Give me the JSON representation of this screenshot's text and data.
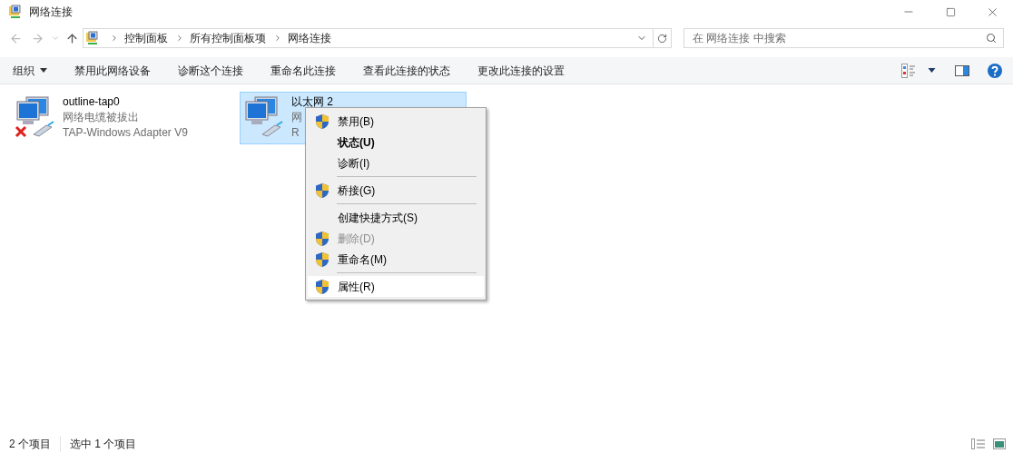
{
  "window": {
    "title": "网络连接"
  },
  "breadcrumb": [
    "控制面板",
    "所有控制面板项",
    "网络连接"
  ],
  "search": {
    "placeholder": "在 网络连接 中搜索"
  },
  "toolbar": [
    {
      "label": "组织",
      "dropdown": true
    },
    {
      "label": "禁用此网络设备",
      "dropdown": false
    },
    {
      "label": "诊断这个连接",
      "dropdown": false
    },
    {
      "label": "重命名此连接",
      "dropdown": false
    },
    {
      "label": "查看此连接的状态",
      "dropdown": false
    },
    {
      "label": "更改此连接的设置",
      "dropdown": false
    }
  ],
  "connections": [
    {
      "name": "outline-tap0",
      "status": "网络电缆被拔出",
      "device": "TAP-Windows Adapter V9",
      "selected": false,
      "disconnected": true
    },
    {
      "name": "以太网 2",
      "status": "网",
      "device": "R",
      "selected": true,
      "disconnected": false
    }
  ],
  "context_menu": [
    {
      "kind": "item",
      "label": "禁用(B)",
      "shield": true,
      "bold": false,
      "disabled": false,
      "selected": false
    },
    {
      "kind": "item",
      "label": "状态(U)",
      "shield": false,
      "bold": true,
      "disabled": false,
      "selected": false
    },
    {
      "kind": "item",
      "label": "诊断(I)",
      "shield": false,
      "bold": false,
      "disabled": false,
      "selected": false
    },
    {
      "kind": "separator"
    },
    {
      "kind": "item",
      "label": "桥接(G)",
      "shield": true,
      "bold": false,
      "disabled": false,
      "selected": false
    },
    {
      "kind": "separator"
    },
    {
      "kind": "item",
      "label": "创建快捷方式(S)",
      "shield": false,
      "bold": false,
      "disabled": false,
      "selected": false
    },
    {
      "kind": "item",
      "label": "删除(D)",
      "shield": true,
      "bold": false,
      "disabled": true,
      "selected": false
    },
    {
      "kind": "item",
      "label": "重命名(M)",
      "shield": true,
      "bold": false,
      "disabled": false,
      "selected": false
    },
    {
      "kind": "separator"
    },
    {
      "kind": "item",
      "label": "属性(R)",
      "shield": true,
      "bold": false,
      "disabled": false,
      "selected": true
    }
  ],
  "status_bar": [
    "2 个项目",
    "选中 1 个项目"
  ]
}
